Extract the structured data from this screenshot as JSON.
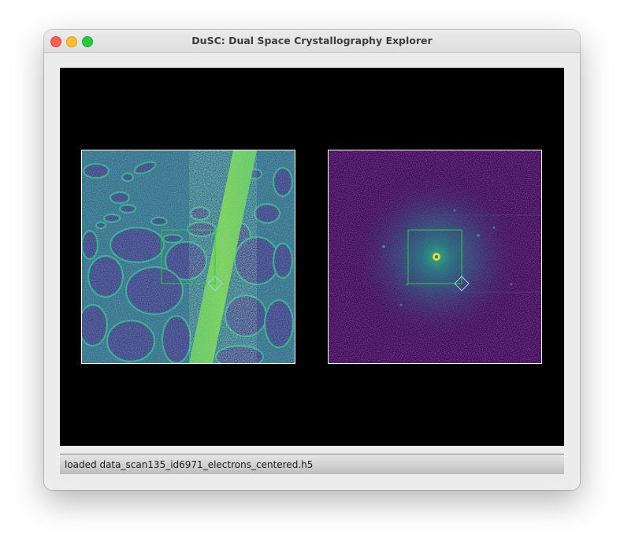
{
  "window": {
    "title": "DuSC: Dual Space Crystallography Explorer"
  },
  "panels": {
    "real_space": {
      "colormap": "viridis"
    },
    "diffraction": {
      "colormap": "viridis"
    }
  },
  "colors": {
    "roi": "#2ecc40",
    "handle": "#9fd0ff",
    "panel_border": "#ffffff",
    "background": "#000000"
  },
  "status": {
    "message": "loaded data_scan135_id6971_electrons_centered.h5"
  }
}
